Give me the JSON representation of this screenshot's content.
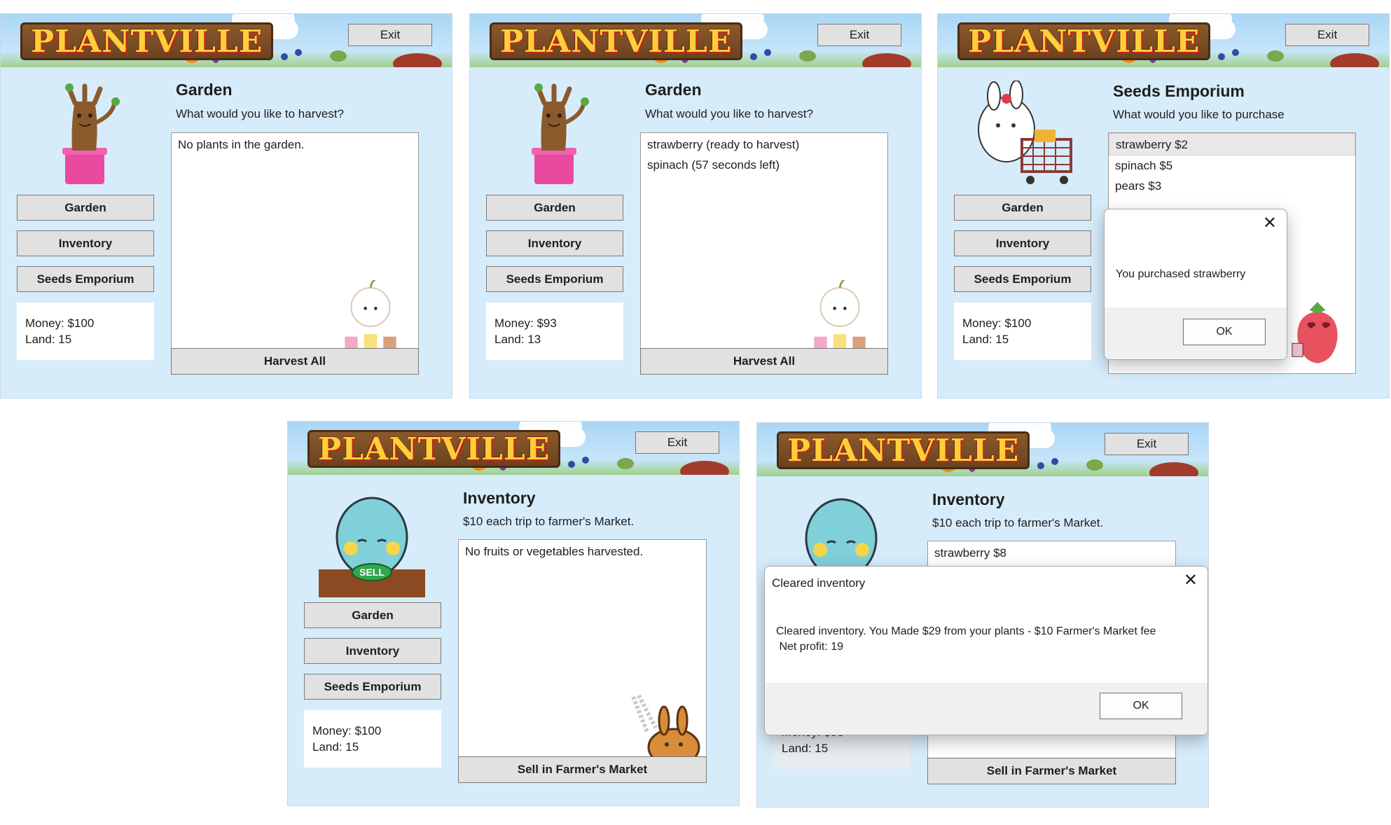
{
  "app": {
    "logo": "PLANTVILLE",
    "exit_label": "Exit"
  },
  "nav": {
    "garden": "Garden",
    "inventory": "Inventory",
    "seeds": "Seeds Emporium"
  },
  "windows": [
    {
      "title": "Garden",
      "subtitle": "What would you like to harvest?",
      "items": [
        "No plants in the garden."
      ],
      "action": "Harvest All",
      "money": "Money: $100",
      "land": "Land: 15"
    },
    {
      "title": "Garden",
      "subtitle": "What would you like to harvest?",
      "items": [
        "strawberry (ready to harvest)",
        "spinach (57 seconds left)"
      ],
      "action": "Harvest All",
      "money": "Money: $93",
      "land": "Land: 13"
    },
    {
      "title": "Seeds Emporium",
      "subtitle": "What would you like to purchase",
      "items": [
        "strawberry $2",
        "spinach $5",
        "pears $3"
      ],
      "money": "Money: $100",
      "land": "Land: 15",
      "dialog": {
        "message": "You purchased strawberry",
        "ok": "OK"
      }
    },
    {
      "title": "Inventory",
      "subtitle": "$10 each trip to farmer's Market.",
      "items": [
        "No fruits or vegetables harvested."
      ],
      "action": "Sell in Farmer's Market",
      "money": "Money: $100",
      "land": "Land: 15"
    },
    {
      "title": "Inventory",
      "subtitle": "$10 each trip to farmer's Market.",
      "items": [
        "strawberry $8"
      ],
      "action": "Sell in Farmer's Market",
      "money": "Money: $93",
      "land": "Land: 15",
      "dialog": {
        "title": "Cleared inventory",
        "message": "Cleared inventory. You Made $29 from your plants - $10 Farmer's Market fee",
        "message2": " Net profit: 19",
        "ok": "OK"
      }
    }
  ],
  "mascot_sell_label": "SELL"
}
